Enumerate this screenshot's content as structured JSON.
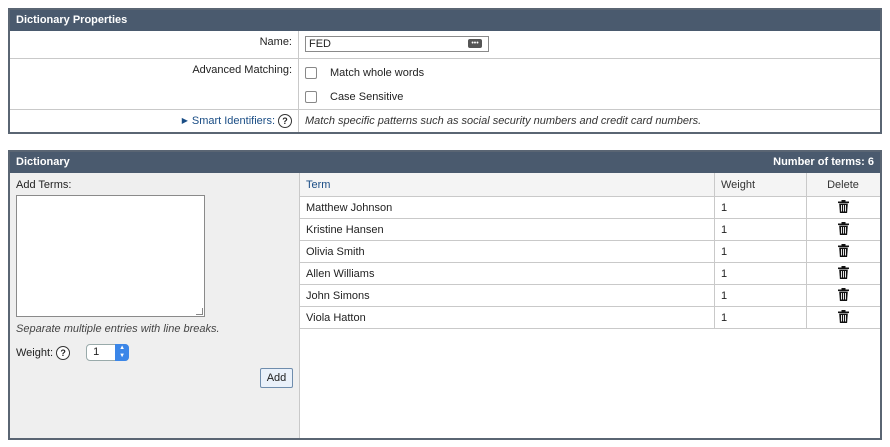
{
  "properties": {
    "header": "Dictionary Properties",
    "name_label": "Name:",
    "name_value": "FED",
    "advanced_label": "Advanced Matching:",
    "match_whole_words": "Match whole words",
    "case_sensitive": "Case Sensitive",
    "smart_label": "Smart Identifiers:",
    "smart_hint": "Match specific patterns such as social security numbers and credit card numbers."
  },
  "dictionary": {
    "header": "Dictionary",
    "count_text": "Number of terms: 6",
    "add_terms_label": "Add Terms:",
    "hint": "Separate multiple entries with line breaks.",
    "weight_label": "Weight:",
    "weight_value": "1",
    "add_button": "Add",
    "columns": {
      "term": "Term",
      "weight": "Weight",
      "delete": "Delete"
    },
    "rows": [
      {
        "term": "Matthew Johnson",
        "weight": "1"
      },
      {
        "term": "Kristine Hansen",
        "weight": "1"
      },
      {
        "term": "Olivia Smith",
        "weight": "1"
      },
      {
        "term": "Allen Williams",
        "weight": "1"
      },
      {
        "term": "John Simons",
        "weight": "1"
      },
      {
        "term": "Viola Hatton",
        "weight": "1"
      }
    ]
  },
  "icons": {
    "help": "help-icon",
    "delete": "trash-icon",
    "expand": "triangle-right-icon"
  },
  "colors": {
    "header_bg": "#4a5a6e",
    "link": "#1a4d85",
    "stepper": "#3b86e8"
  }
}
